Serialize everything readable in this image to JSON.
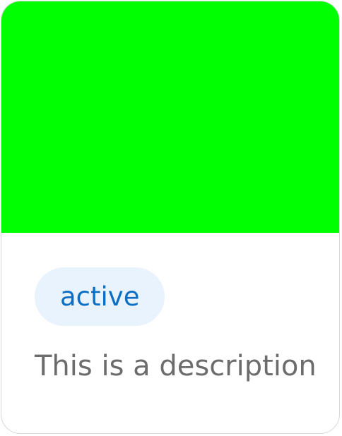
{
  "card": {
    "media_color": "#00ff00",
    "status_badge": "active",
    "description": "This is a description"
  },
  "colors": {
    "badge_background": "#e8f3fd",
    "badge_text": "#0d6fc4",
    "description_text": "#6c6c6c",
    "card_border": "#d8d8d8"
  }
}
